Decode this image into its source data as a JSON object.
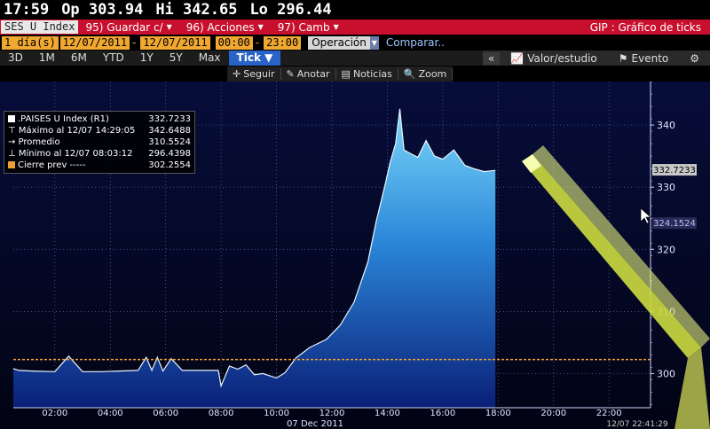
{
  "quote": {
    "time": "17:59",
    "open": "Op 303.94",
    "high": "Hi 342.65",
    "low": "Lo 296.44"
  },
  "command_bar": {
    "ticker": "SES U Index",
    "save": "95) Guardar c/",
    "actions": "96) Acciones",
    "change": "97) Camb",
    "right_title": "GIP : Gráfico de ticks"
  },
  "date_bar": {
    "period": "1 día(s)",
    "start_date": "12/07/2011",
    "end_date": "12/07/2011",
    "start_time": "00:00",
    "end_time": "23:00",
    "mode": "Operación",
    "compare": "Comparar.."
  },
  "period_tabs": [
    "3D",
    "1M",
    "6M",
    "YTD",
    "1Y",
    "5Y",
    "Max",
    "Tick ▼"
  ],
  "view_tabs": {
    "collapse": "«",
    "study": "Valor/estudio",
    "event": "Evento",
    "settings": "⚙"
  },
  "toolbar": [
    "Seguir",
    "Anotar",
    "Noticias",
    "Zoom"
  ],
  "legend": {
    "name": ".PAISES U Index (R1)",
    "name_value": "332.7233",
    "max_label": "Máximo al 12/07 14:29:05",
    "max_value": "342.6488",
    "avg_label": "Promedio",
    "avg_value": "310.5524",
    "min_label": "Mínimo al 12/07 08:03:12",
    "min_value": "296.4398",
    "prev_label": "Cierre prev -----",
    "prev_value": "302.2554"
  },
  "chart_data": {
    "type": "area",
    "xlabel": "07 Dec 2011",
    "x_tick_labels": [
      "02:00",
      "04:00",
      "06:00",
      "08:00",
      "10:00",
      "12:00",
      "14:00",
      "16:00",
      "18:00",
      "20:00",
      "22:00"
    ],
    "x_range_hours": [
      0.5,
      23.5
    ],
    "y_tick_labels": [
      "300",
      "310",
      "320",
      "330",
      "340"
    ],
    "ylim": [
      294.5,
      347
    ],
    "last_value_label": "332.7233",
    "cursor_value_label": "324.1524",
    "footer_timestamp": "12/07 22:41:29",
    "prev_close": 302.2554,
    "grid": true,
    "x": [
      0.5,
      0.7,
      1.2,
      2.0,
      2.5,
      3.0,
      3.7,
      4.3,
      5.0,
      5.3,
      5.5,
      5.7,
      5.9,
      6.2,
      6.6,
      7.0,
      7.4,
      7.9,
      8.0,
      8.3,
      8.6,
      8.9,
      9.2,
      9.5,
      10.0,
      10.3,
      10.7,
      11.2,
      11.8,
      12.3,
      12.8,
      13.3,
      13.6,
      13.9,
      14.1,
      14.3,
      14.45,
      14.6,
      14.8,
      15.1,
      15.4,
      15.7,
      16.0,
      16.4,
      16.8,
      17.1,
      17.5,
      17.9
    ],
    "values": [
      300.8,
      300.5,
      300.4,
      300.3,
      302.8,
      300.3,
      300.3,
      300.4,
      300.5,
      302.6,
      300.5,
      302.6,
      300.4,
      302.4,
      300.5,
      300.5,
      300.5,
      300.5,
      298.0,
      301.2,
      300.7,
      301.4,
      299.8,
      300.0,
      299.3,
      300.1,
      302.5,
      304.2,
      305.5,
      307.8,
      311.5,
      318.0,
      324.5,
      330.0,
      334.0,
      337.0,
      342.6,
      336.0,
      335.5,
      334.8,
      337.5,
      335.0,
      334.5,
      336.0,
      333.5,
      333.0,
      332.5,
      332.7
    ]
  }
}
